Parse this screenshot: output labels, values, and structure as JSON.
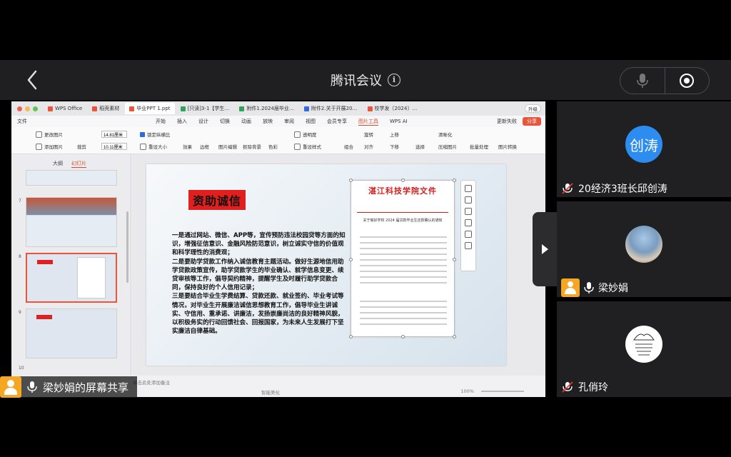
{
  "meeting": {
    "title": "腾讯会议",
    "share_label": "梁妙娟的屏幕共享"
  },
  "icons": {
    "back": "chevron-left-icon",
    "info": "info-icon",
    "mic": "microphone-icon",
    "record": "record-icon",
    "expand": "chevron-right-icon"
  },
  "wps": {
    "tabs": [
      {
        "label": "WPS Office",
        "color": "#e8553b"
      },
      {
        "label": "稻壳素材",
        "color": "#e8553b"
      },
      {
        "label": "毕业PPT 1.ppt",
        "color": "#e8553b"
      },
      {
        "label": "[只读]3-1【学生…",
        "color": "#2fa35b"
      },
      {
        "label": "附件1.2024届毕业…",
        "color": "#2fa35b"
      },
      {
        "label": "附件2.关于开展20…",
        "color": "#2f6be0"
      },
      {
        "label": "校学发〔2024〕…",
        "color": "#e8553b"
      }
    ],
    "upgrade": "升级",
    "menus": [
      "开始",
      "插入",
      "设计",
      "切换",
      "动画",
      "放映",
      "审阅",
      "视图",
      "会员专享",
      "图片工具",
      "WPS AI"
    ],
    "file_menu": "文件",
    "sync_status": "更新失败",
    "share_button": "分享",
    "ribbon": {
      "change_pic": "更改图片",
      "add_pic": "添加图片",
      "crop": "裁剪",
      "width": "14.81厘米",
      "height": "10.11厘米",
      "lock_ratio": "锁定纵横比",
      "reset_size": "重设大小",
      "effects": "效果",
      "border": "边框",
      "pic_edit": "图片编辑",
      "crop_bg": "抠除背景",
      "color": "色彩",
      "opacity": "透明度",
      "reset_style": "重设样式",
      "group": "组合",
      "rotate": "旋转",
      "align": "对齐",
      "bring_up": "上移",
      "send_down": "下移",
      "select": "选择",
      "sharpen": "清晰化",
      "compress": "压缩图片",
      "batch": "批量处理",
      "convert": "图片转换"
    },
    "sidebar_tabs": [
      "大纲",
      "幻灯片"
    ],
    "slide_numbers": [
      "7",
      "8",
      "9",
      "10"
    ],
    "notes_placeholder": "单击此处添加备注",
    "status_smart": "智能美化",
    "zoom": "100%"
  },
  "slide": {
    "title": "资助诚信",
    "body": "一是通过网站、微信、APP等，宣传预防违法校园贷等方面的知识，增强征信意识、金融风险防范意识，树立诚实守信的价值观和科学理性的消费观；\n二是要助学贷款工作纳入诚信教育主题活动。做好生源地信用助学贷款政策宣传，助学贷款学生的毕业确认、就学信息变更、续贷审核等工作，倡导契约精神，提醒学生及时履行助学贷款合同，保持良好的个人信用记录；\n三是要结合毕业生学费结算、贷款还款、就业签约、毕业考试等情况，对毕业生开展廉洁诚信思想教育工作，倡导毕业生讲诚实、守信用、重承诺、讲廉洁，发扬崇廉尚洁的良好精神风貌，以积极务实的行动回馈社会、回报国家，为未来人生发展打下坚实廉洁自律基础。",
    "doc_header": "湛江科技学院文件",
    "doc_title": "关于做好学校 2024 届贷款毕业生还款确认的通知"
  },
  "participants": [
    {
      "name": "20经济3班长邱创涛",
      "avatar_text": "创涛",
      "muted": true
    },
    {
      "name": "梁妙娟",
      "muted": false,
      "host": true
    },
    {
      "name": "孔俏玲",
      "muted": true
    }
  ],
  "colors": {
    "accent": "#e8553b",
    "avatar_blue": "#2d8cf0",
    "host_orange": "#f5a623",
    "title_red": "#e21f1f"
  }
}
